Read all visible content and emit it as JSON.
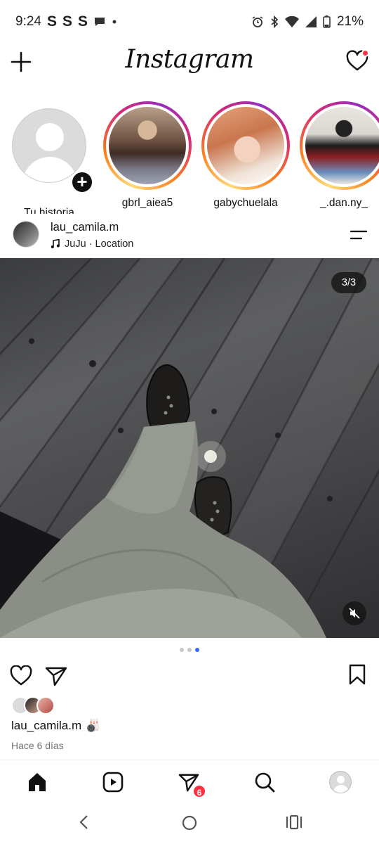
{
  "status_bar": {
    "time": "9:24",
    "notification_icons": [
      "S",
      "S",
      "S"
    ],
    "battery": "21%"
  },
  "header": {
    "logo": "Instagram",
    "has_activity_dot": true
  },
  "stories": [
    {
      "name": "Tu historia",
      "own": true
    },
    {
      "name": "gbrl_aiea5",
      "own": false
    },
    {
      "name": "gabychuelala",
      "own": false
    },
    {
      "name": "_.dan.ny_",
      "own": false
    }
  ],
  "post": {
    "username": "lau_camila.m",
    "music": "JuJu · Location",
    "counter": "3/3",
    "carousel_count": 3,
    "carousel_active": 3,
    "caption_user": "lau_camila.m",
    "caption_emoji": "🎳",
    "time_ago": "Hace 6 días"
  },
  "bottom_nav": {
    "items": [
      "home-icon",
      "reels-icon",
      "messages-icon",
      "search-icon",
      "profile-icon"
    ],
    "messages_badge": "6"
  },
  "colors": {
    "badge": "#ff3040",
    "carousel_dot_active": "#3f66f5"
  }
}
